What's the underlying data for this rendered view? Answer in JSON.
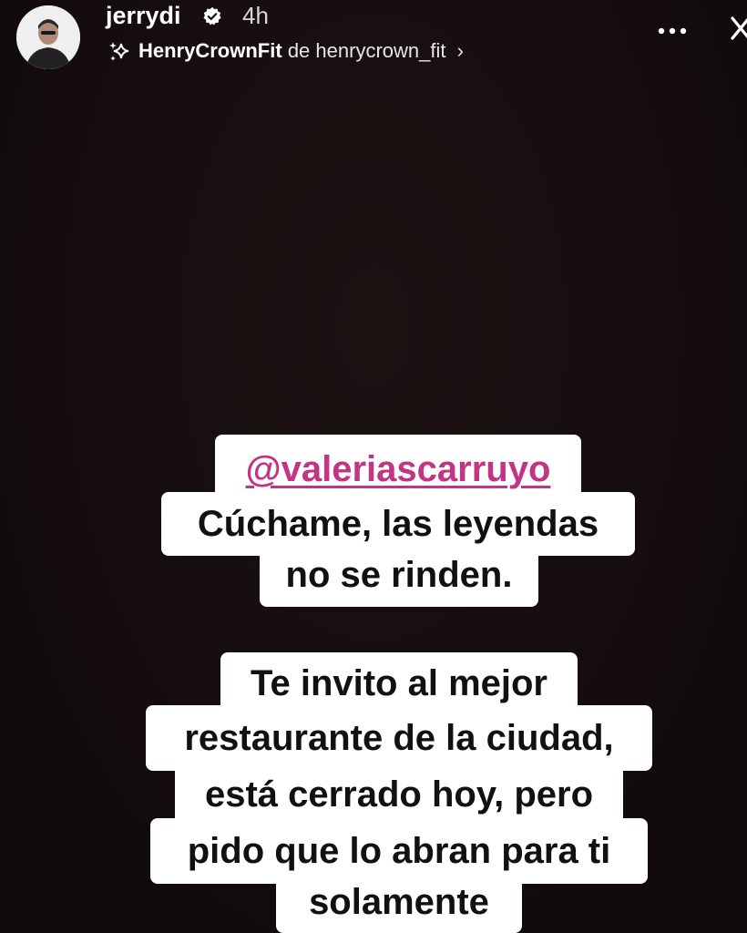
{
  "header": {
    "username": "jerrydi",
    "verified_icon": "verified-badge-icon",
    "time_ago": "4h",
    "music": {
      "icon": "sparkle-icon",
      "title": "HenryCrownFit",
      "separator": "de",
      "artist": "henrycrown_fit",
      "chevron": "›"
    },
    "more_icon": "more-horizontal-icon",
    "close_icon": "close-icon"
  },
  "stickers": {
    "mention": "@valeriascarruyo",
    "block1": [
      "Cúchame, las leyendas",
      "no se rinden."
    ],
    "block2": [
      "Te invito al mejor",
      "restaurante de la ciudad,",
      "está cerrado hoy, pero",
      "pido que lo abran para ti",
      "solamente"
    ]
  },
  "colors": {
    "background": "#150d0e",
    "mention": "#c13584",
    "sticker_bg": "#ffffff",
    "sticker_text": "#111111"
  }
}
